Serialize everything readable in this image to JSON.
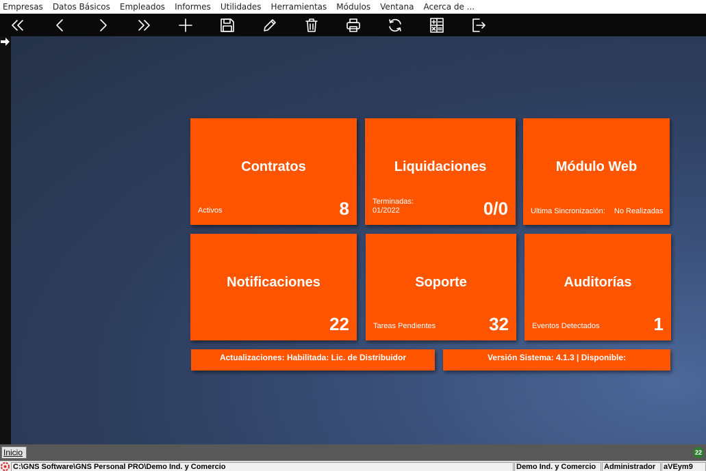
{
  "menu": [
    "Empresas",
    "Datos Básicos",
    "Empleados",
    "Informes",
    "Utilidades",
    "Herramientas",
    "Módulos",
    "Ventana",
    "Acerca de ..."
  ],
  "toolbar": {
    "icons": [
      "first-record-icon",
      "previous-record-icon",
      "next-record-icon",
      "last-record-icon",
      "add-icon",
      "save-icon",
      "edit-icon",
      "delete-icon",
      "print-icon",
      "refresh-icon",
      "calculator-icon",
      "exit-icon"
    ]
  },
  "tiles": {
    "contratos": {
      "title": "Contratos",
      "label": "Activos",
      "count": "8"
    },
    "liquidaciones": {
      "title": "Liquidaciones",
      "label_line1": "Terminadas:",
      "label_line2": "01/2022",
      "count": "0/0"
    },
    "modulo_web": {
      "title": "Módulo Web",
      "label": "Ultima Sincronización:",
      "value": "No Realizadas"
    },
    "notificaciones": {
      "title": "Notificaciones",
      "count": "22"
    },
    "soporte": {
      "title": "Soporte",
      "label": "Tareas Pendientes",
      "count": "32"
    },
    "auditorias": {
      "title": "Auditorías",
      "label": "Eventos Detectados",
      "count": "1"
    }
  },
  "bars": {
    "actualizaciones": "Actualizaciones: Habilitada: Lic. de Distribuidor",
    "version": "Versión Sistema: 4.1.3 | Disponible:"
  },
  "tabbar": {
    "tab_label": "Inicio",
    "badge": "22"
  },
  "statusbar": {
    "path": "C:\\GNS Software\\GNS Personal PRO\\Demo Ind. y Comercio",
    "company": "Demo Ind. y Comercio",
    "user": "Administrador",
    "code": "aVEym9"
  },
  "colors": {
    "accent": "#ff5500",
    "toolbar": "#0a0a0a",
    "background": "#2d3d5c"
  }
}
